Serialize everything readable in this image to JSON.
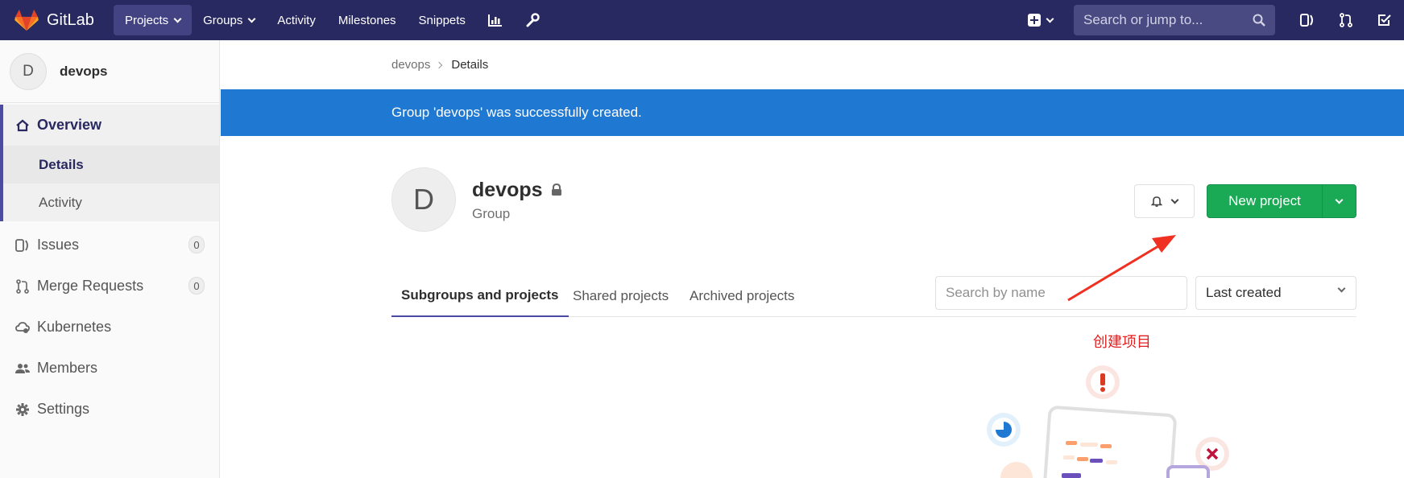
{
  "navbar": {
    "brand": "GitLab",
    "items": [
      {
        "label": "Projects",
        "dropdown": true,
        "active": true
      },
      {
        "label": "Groups",
        "dropdown": true,
        "active": false
      },
      {
        "label": "Activity",
        "dropdown": false,
        "active": false
      },
      {
        "label": "Milestones",
        "dropdown": false,
        "active": false
      },
      {
        "label": "Snippets",
        "dropdown": false,
        "active": false
      }
    ],
    "icons": [
      "chart-icon",
      "wrench-icon"
    ],
    "search_placeholder": "Search or jump to...",
    "right_icons": [
      "plus-icon",
      "issues-icon",
      "merge-request-icon",
      "todo-icon"
    ]
  },
  "sidebar": {
    "context_avatar": "D",
    "context_name": "devops",
    "overview_label": "Overview",
    "sub_items": [
      {
        "label": "Details",
        "active": true
      },
      {
        "label": "Activity",
        "active": false
      }
    ],
    "items": [
      {
        "label": "Issues",
        "icon": "issues-icon",
        "count": "0"
      },
      {
        "label": "Merge Requests",
        "icon": "merge-request-icon",
        "count": "0"
      },
      {
        "label": "Kubernetes",
        "icon": "kubernetes-icon",
        "count": null
      },
      {
        "label": "Members",
        "icon": "members-icon",
        "count": null
      },
      {
        "label": "Settings",
        "icon": "settings-icon",
        "count": null
      }
    ]
  },
  "breadcrumb": {
    "parent": "devops",
    "current": "Details"
  },
  "flash": {
    "message": "Group 'devops' was successfully created."
  },
  "group": {
    "avatar": "D",
    "name": "devops",
    "type": "Group"
  },
  "actions": {
    "new_project": "New project"
  },
  "tabs": [
    "Subgroups and projects",
    "Shared projects",
    "Archived projects"
  ],
  "filter": {
    "search_placeholder": "Search by name",
    "sort_value": "Last created"
  },
  "annotation": {
    "text": "创建项目",
    "color": "#e02020"
  },
  "colors": {
    "navbar": "#292961",
    "flash": "#1f78d1",
    "primary_button": "#1aaa55",
    "accent": "#4b4ba3"
  }
}
